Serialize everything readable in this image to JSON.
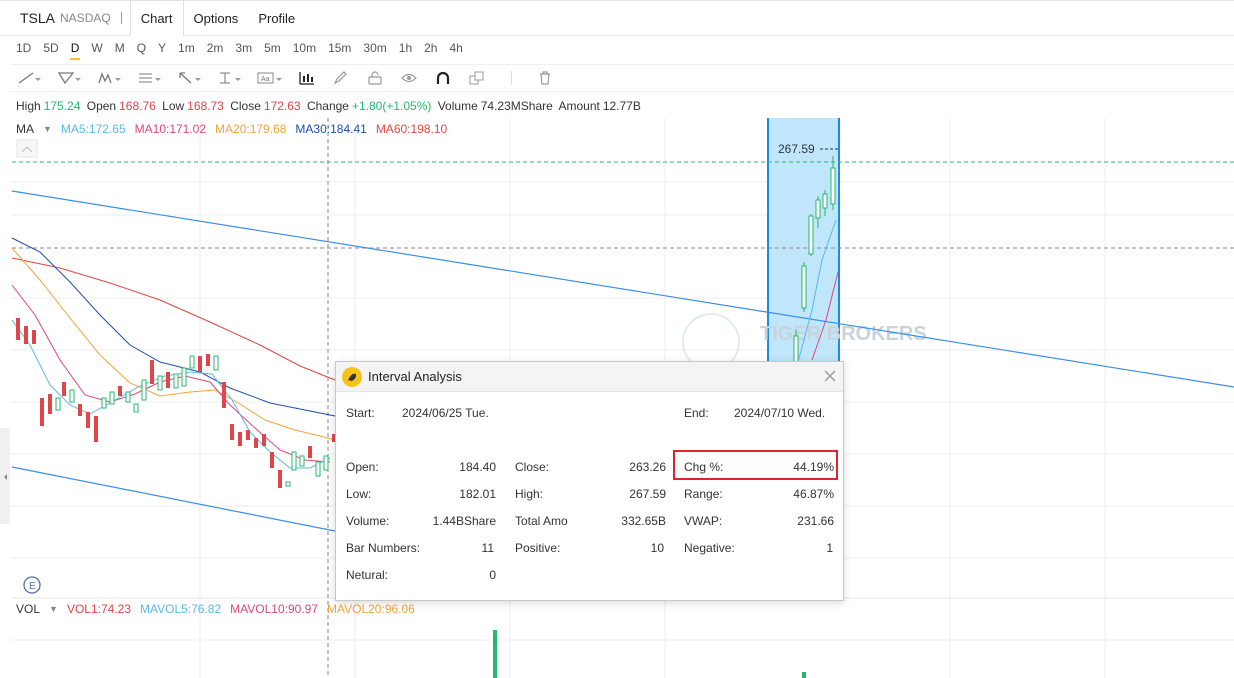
{
  "header": {
    "symbol": "TSLA",
    "exchange": "NASDAQ",
    "tabs": [
      "Chart",
      "Options",
      "Profile"
    ],
    "active_tab": "Chart"
  },
  "periods": [
    "1D",
    "5D",
    "D",
    "W",
    "M",
    "Q",
    "Y",
    "1m",
    "2m",
    "3m",
    "5m",
    "10m",
    "15m",
    "30m",
    "1h",
    "2h",
    "4h"
  ],
  "selected_period": "D",
  "toolbar_icons": [
    "line-tool-icon",
    "shape-tool-icon",
    "pattern-tool-icon",
    "fib-tool-icon",
    "arrow-tool-icon",
    "measure-tool-icon",
    "text-tool-icon",
    "interval-analysis-icon",
    "pen-icon",
    "lock-icon",
    "visibility-icon",
    "magnet-icon",
    "copy-icon",
    "delete-icon"
  ],
  "ohlc": {
    "high_label": "High",
    "high": "175.24",
    "open_label": "Open",
    "open": "168.76",
    "low_label": "Low",
    "low": "168.73",
    "close_label": "Close",
    "close": "172.63",
    "change_label": "Change",
    "change": "+1.80(+1.05%)",
    "volume_label": "Volume",
    "volume": "74.23MShare",
    "amount_label": "Amount",
    "amount": "12.77B"
  },
  "ma": {
    "label": "MA",
    "items": [
      {
        "text": "MA5:172.65",
        "color": "#5ab8ea"
      },
      {
        "text": "MA10:171.02",
        "color": "#e2457a"
      },
      {
        "text": "MA20:179.68",
        "color": "#f0a53a"
      },
      {
        "text": "MA30:184.41",
        "color": "#1d4fb0"
      },
      {
        "text": "MA60:198.10",
        "color": "#e5453f"
      }
    ]
  },
  "vol": {
    "label": "VOL",
    "items": [
      {
        "text": "VOL1:74.23",
        "color": "#e0454a"
      },
      {
        "text": "MAVOL5:76.82",
        "color": "#5ab8ea"
      },
      {
        "text": "MAVOL10:90.97",
        "color": "#e2457a"
      },
      {
        "text": "MAVOL20:96.06",
        "color": "#f0a53a"
      }
    ]
  },
  "price_marker": "267.59",
  "event_marker": "E",
  "watermark": "TIGER BROKERS",
  "dialog": {
    "title": "Interval Analysis",
    "start_label": "Start:",
    "start": "2024/06/25 Tue.",
    "end_label": "End:",
    "end": "2024/07/10 Wed.",
    "open_label": "Open:",
    "open": "184.40",
    "close_label": "Close:",
    "close": "263.26",
    "chg_label": "Chg %:",
    "chg": "44.19%",
    "low_label": "Low:",
    "low": "182.01",
    "high_label": "High:",
    "high": "267.59",
    "range_label": "Range:",
    "range": "46.87%",
    "volume_label": "Volume:",
    "volume": "1.44BShare",
    "amount_label": "Total Amo",
    "amount": "332.65B",
    "vwap_label": "VWAP:",
    "vwap": "231.66",
    "bars_label": "Bar Numbers:",
    "bars": "11",
    "positive_label": "Positive:",
    "positive": "10",
    "negative_label": "Negative:",
    "negative": "1",
    "neutral_label": "Netural:",
    "neutral": "0"
  },
  "colors": {
    "up": "#26b86e",
    "down": "#e0454a",
    "selection": "#bfe6fb",
    "selection_border": "#1e88e5",
    "trendline": "#3a8ee6",
    "highlight_box": "#e0242b"
  }
}
